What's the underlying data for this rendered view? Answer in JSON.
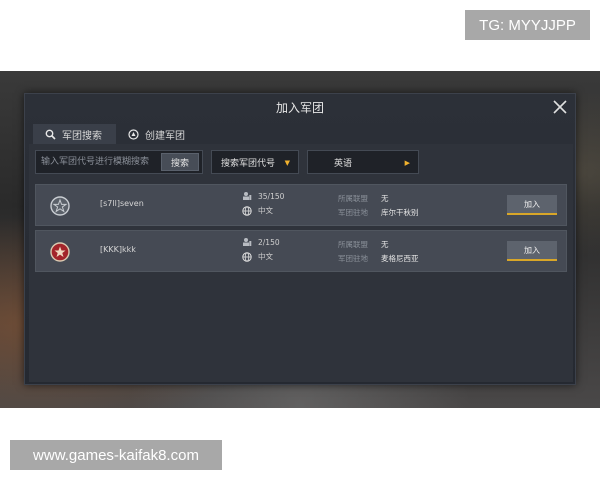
{
  "watermarks": {
    "top": "TG: MYYJJPP",
    "bottom": "www.games-kaifak8.com"
  },
  "dialog": {
    "title": "加入军团",
    "close_icon": "close-icon"
  },
  "tabs": [
    {
      "label": "军团搜索",
      "icon": "search-icon",
      "active": true
    },
    {
      "label": "创建军团",
      "icon": "create-legion-icon",
      "active": false
    }
  ],
  "search": {
    "placeholder": "输入军团代号进行模糊搜索",
    "button_label": "搜索"
  },
  "filters": {
    "code_dropdown": "搜索军团代号",
    "language_dropdown": "英语"
  },
  "legions": [
    {
      "name": "[s7ll]seven",
      "members": "35/150",
      "language": "中文",
      "alliance_label": "所属联盟",
      "alliance_value": "无",
      "base_label": "军团驻地",
      "base_value": "库尔干秋别",
      "join_label": "加入",
      "emblem_icon": "star-emblem-icon",
      "emblem_color": "#c9cdd2"
    },
    {
      "name": "[KKK]kkk",
      "members": "2/150",
      "language": "中文",
      "alliance_label": "所属联盟",
      "alliance_value": "无",
      "base_label": "军团驻地",
      "base_value": "麦格尼西亚",
      "join_label": "加入",
      "emblem_icon": "red-star-emblem-icon",
      "emblem_color": "#a3242a"
    }
  ],
  "colors": {
    "accent": "#d8a628",
    "dialog_bg": "#2c3038",
    "row_bg": "#454a54"
  }
}
